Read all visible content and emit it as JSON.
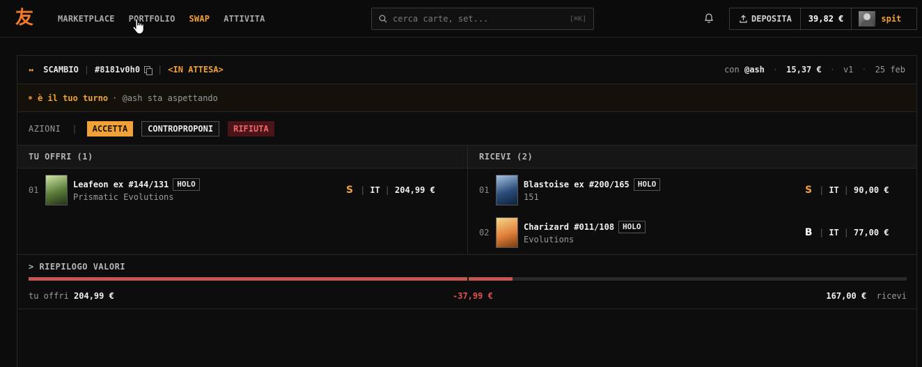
{
  "brand": {
    "logo": "友"
  },
  "nav": {
    "items": [
      {
        "label": "MARKETPLACE",
        "active": false
      },
      {
        "label": "PORTFOLIO",
        "active": false
      },
      {
        "label": "SWAP",
        "active": true
      },
      {
        "label": "ATTIVITA",
        "active": false
      }
    ]
  },
  "search": {
    "placeholder": "cerca carte, set...",
    "shortcut": "[⌘K]"
  },
  "wallet": {
    "deposit_label": "DEPOSITA",
    "balance": "39,82 €",
    "username": "spit"
  },
  "trade": {
    "icon": "↔",
    "type_label": "SCAMBIO",
    "id": "#8181v0h0",
    "status": "<IN ATTESA>",
    "with_prefix": "con",
    "with_user": "@ash",
    "amount": "15,37 €",
    "version": "v1",
    "date": "25 feb"
  },
  "turn": {
    "main": "è il tuo turno",
    "detail": "· @ash sta aspettando"
  },
  "actions": {
    "label": "AZIONI",
    "accept": "ACCETTA",
    "counter": "CONTROPROPONI",
    "reject": "RIFIUTA"
  },
  "offer": {
    "title": "TU OFFRI (1)",
    "items": [
      {
        "index": "01",
        "name": "Leafeon ex #144/131",
        "badge": "HOLO",
        "set": "Prismatic Evolutions",
        "grade": "S",
        "lang": "IT",
        "price": "204,99 €"
      }
    ]
  },
  "receive": {
    "title": "RICEVI (2)",
    "items": [
      {
        "index": "01",
        "name": "Blastoise ex #200/165",
        "badge": "HOLO",
        "set": "151",
        "grade": "S",
        "lang": "IT",
        "price": "90,00 €"
      },
      {
        "index": "02",
        "name": "Charizard #011/108",
        "badge": "HOLO",
        "set": "Evolutions",
        "grade": "B",
        "lang": "IT",
        "price": "77,00 €"
      }
    ]
  },
  "summary": {
    "title": "> RIEPILOGO VALORI",
    "offer_label": "tu offri",
    "offer_total": "204,99 €",
    "difference": "-37,99 €",
    "receive_total": "167,00 €",
    "receive_label": "ricevi",
    "offer_share": 0.551
  },
  "colors": {
    "accent": "#f0a238",
    "danger": "#c65654",
    "logo": "#f47a2a"
  }
}
